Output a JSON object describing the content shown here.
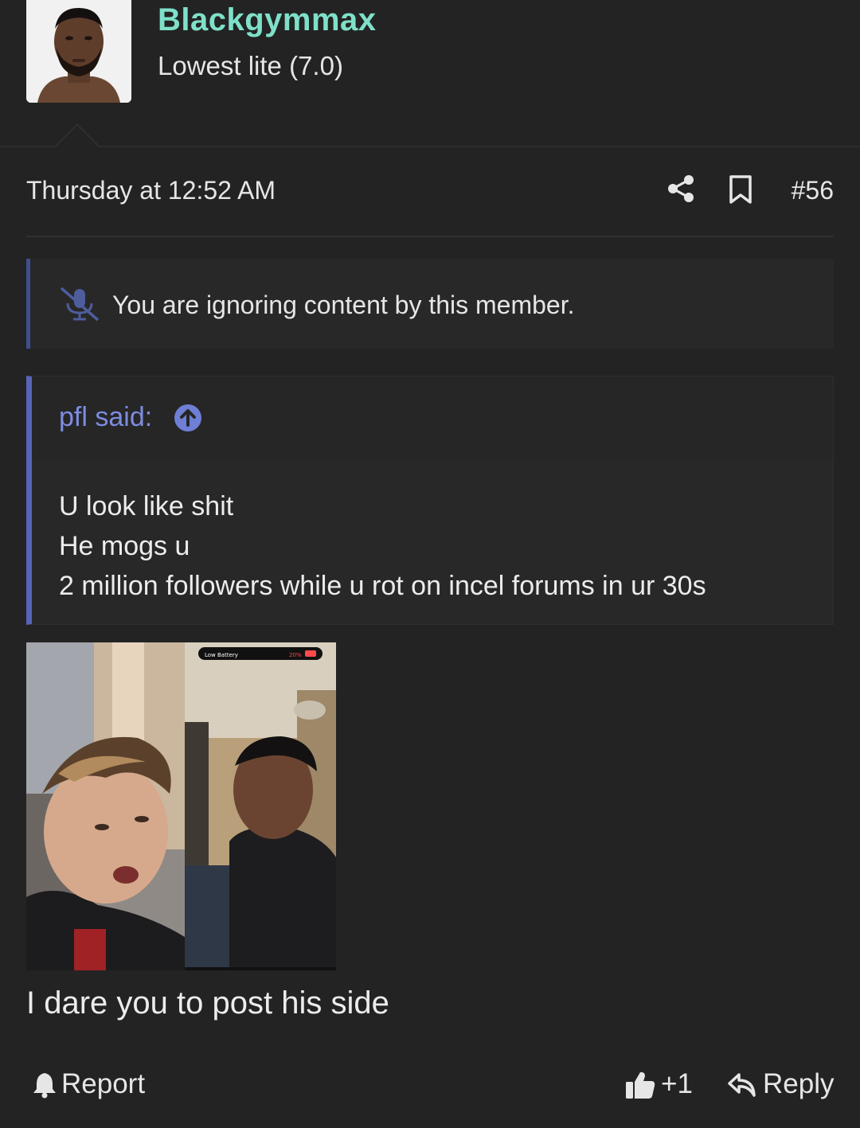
{
  "user": {
    "name": "Blackgymmax",
    "title": "Lowest lite (7.0)",
    "avatar_icon": "user-avatar"
  },
  "post": {
    "timestamp": "Thursday at 12:52 AM",
    "number": "#56",
    "share_icon": "share-icon",
    "bookmark_icon": "bookmark-icon"
  },
  "ignore_notice": {
    "text": "You are ignoring content by this member.",
    "icon": "mute-icon"
  },
  "quote": {
    "author": "pfl said:",
    "lines": [
      "U look like shit",
      "He mogs u",
      "2 million followers while u rot on incel forums in ur 30s"
    ]
  },
  "attachment": {
    "status_bar": "Low Battery",
    "battery": "20%"
  },
  "body_text": "I dare you to post his side",
  "actions": {
    "report": "Report",
    "like": "+1",
    "reply": "Reply"
  },
  "colors": {
    "background": "#232323",
    "username": "#7fe0c9",
    "quote_accent": "#5864b8",
    "ignore_accent": "#3f4f8f",
    "link": "#7d8ce0"
  }
}
